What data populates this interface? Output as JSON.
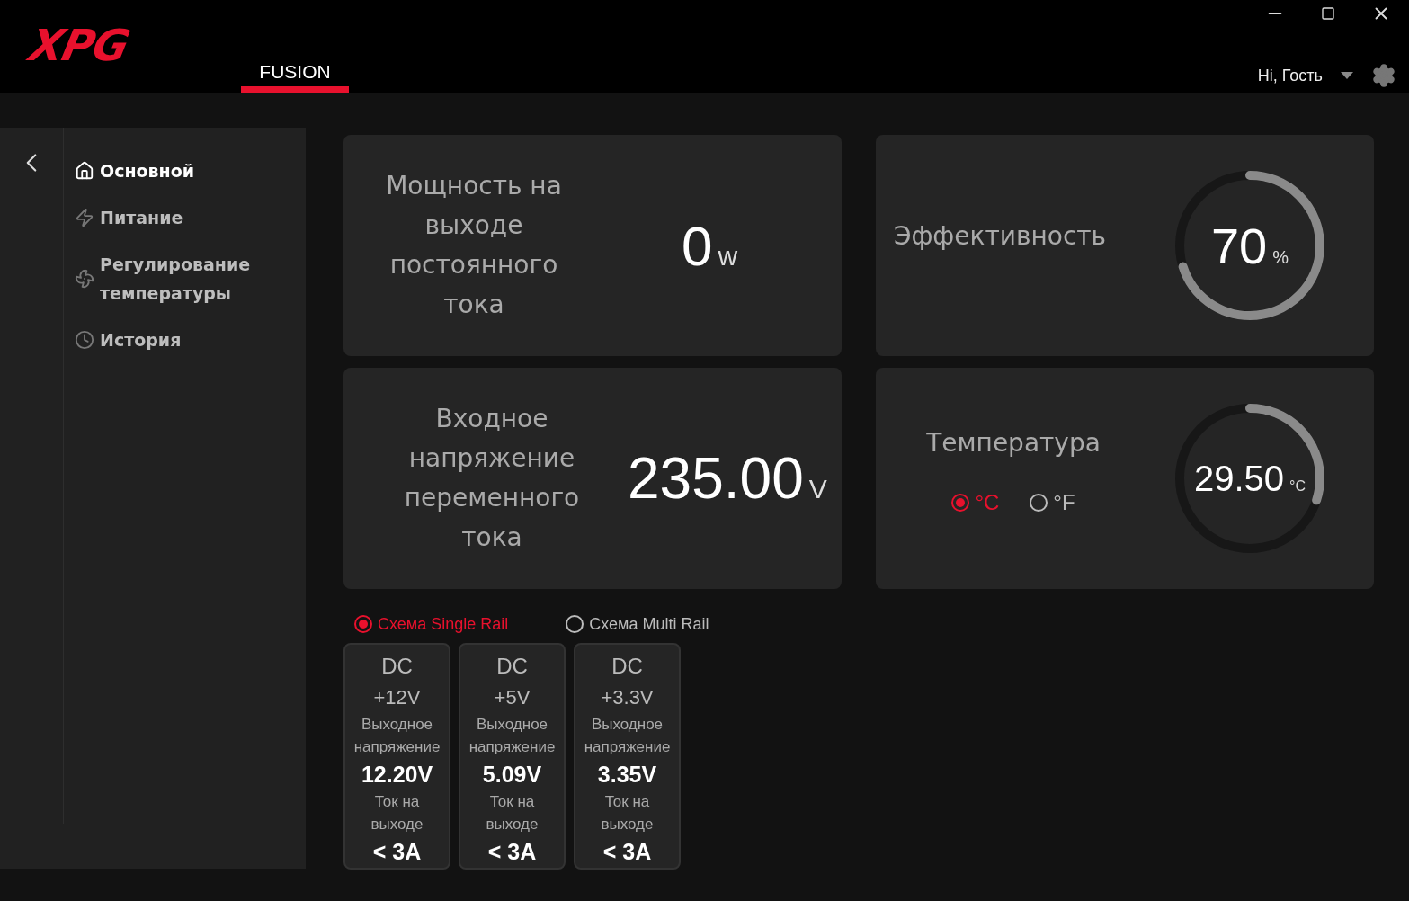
{
  "header": {
    "logo": "XPG",
    "tabs": [
      {
        "label": "FUSION",
        "selected": true
      }
    ],
    "user": "Hi, Гость"
  },
  "sidebar": {
    "items": [
      {
        "label": "Основной",
        "selected": true
      },
      {
        "label": "Питание",
        "selected": false
      },
      {
        "label": "Регулирование температуры",
        "selected": false
      },
      {
        "label": "История",
        "selected": false
      }
    ]
  },
  "cards": [
    {
      "kind": "value",
      "label": "Мощность на выходе постоянного тока",
      "value": "0",
      "unit": "w"
    },
    {
      "kind": "gauge",
      "label": "Эффективность",
      "reading": "70",
      "unit": "%",
      "level": 0.7
    },
    {
      "kind": "value",
      "label": "Входное напряжение переменного тока",
      "value": "235.00",
      "unit": "V"
    },
    {
      "kind": "gauge",
      "label": "Температура",
      "reading": "29.50",
      "unit": "°C",
      "level": 0.3,
      "units": [
        {
          "label": "°C",
          "selected": true
        },
        {
          "label": "°F",
          "selected": false
        }
      ]
    }
  ],
  "rail_modes": [
    {
      "label": "Схема Single Rail",
      "selected": true
    },
    {
      "label": "Схема Multi Rail",
      "selected": false
    }
  ],
  "rails": [
    {
      "type": "DC",
      "rail": "+12V",
      "voltage_label": "Выходное напряжение",
      "voltage": "12.20V",
      "current_label": "Ток на выходе",
      "current": "< 3A"
    },
    {
      "type": "DC",
      "rail": "+5V",
      "voltage_label": "Выходное напряжение",
      "voltage": "5.09V",
      "current_label": "Ток на выходе",
      "current": "< 3A"
    },
    {
      "type": "DC",
      "rail": "+3.3V",
      "voltage_label": "Выходное напряжение",
      "voltage": "3.35V",
      "current_label": "Ток на выходе",
      "current": "< 3A"
    }
  ]
}
